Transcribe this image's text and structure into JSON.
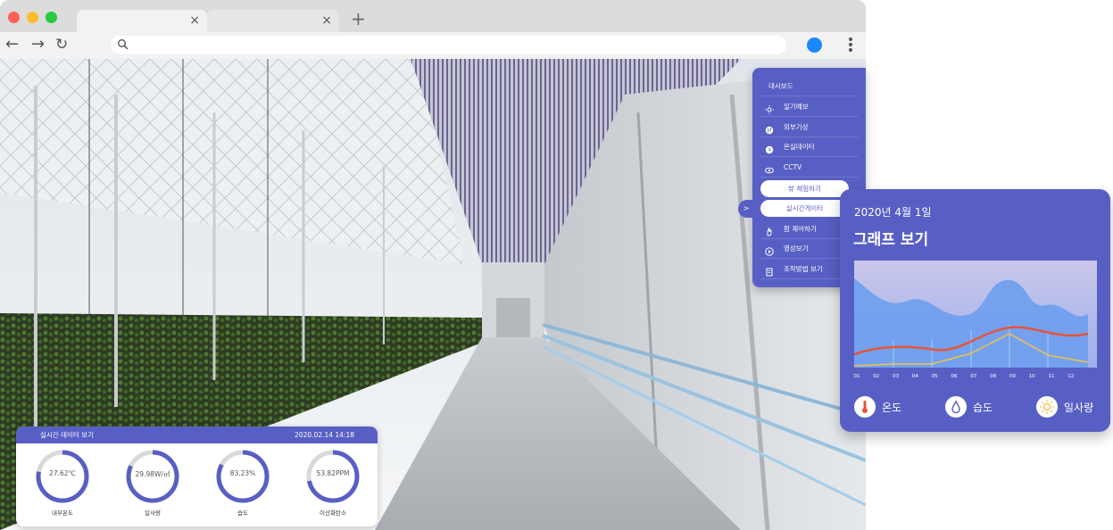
{
  "browser": {
    "tabs": [
      {
        "close": "×"
      },
      {
        "close": "×"
      }
    ],
    "new_tab": "+",
    "back": "←",
    "forward": "→",
    "reload": "↻"
  },
  "sidemenu": {
    "items": [
      {
        "label": "대시보드",
        "icon": ""
      },
      {
        "label": "일기예보",
        "icon": "sun-icon"
      },
      {
        "label": "외부기상",
        "icon": "globe-icon"
      },
      {
        "label": "온실데이터",
        "icon": "clock-icon"
      },
      {
        "label": "CCTV",
        "icon": "eye-icon"
      },
      {
        "label": "뷰 체험하기",
        "icon": "",
        "active": true
      },
      {
        "label": "실시간게이터",
        "icon": "",
        "active": true
      },
      {
        "label": "팜 제어하기",
        "icon": "hand-icon"
      },
      {
        "label": "영상보기",
        "icon": "play-icon"
      },
      {
        "label": "조작방법 보기",
        "icon": "document-icon"
      }
    ],
    "toggle": ">"
  },
  "sensor_panel": {
    "title": "실시간 데이터 보기",
    "datetime": "2020.02.14 14:18",
    "gauges": [
      {
        "value": "27.62℃",
        "label": "내부온도",
        "fraction": 0.78
      },
      {
        "value": "29.98W/㎡",
        "label": "일사량",
        "fraction": 0.82
      },
      {
        "value": "83.23%",
        "label": "습도",
        "fraction": 0.83
      },
      {
        "value": "53.82PPM",
        "label": "이산화탄소",
        "fraction": 0.72
      }
    ],
    "accent": "#585fc4"
  },
  "graph_card": {
    "date": "2020년 4월 1일",
    "title": "그래프 보기",
    "x_ticks": [
      "01",
      "02",
      "03",
      "04",
      "05",
      "06",
      "07",
      "08",
      "09",
      "10",
      "11",
      "12"
    ],
    "legend": [
      {
        "label": "온도",
        "icon": "thermometer-icon"
      },
      {
        "label": "습도",
        "icon": "droplet-icon"
      },
      {
        "label": "일사량",
        "icon": "sun-icon"
      }
    ],
    "colors": {
      "card": "#585fc4",
      "humidity_area": "#7aa8f0",
      "temperature": "#e6553a",
      "sunlight": "#f2c24a"
    }
  }
}
